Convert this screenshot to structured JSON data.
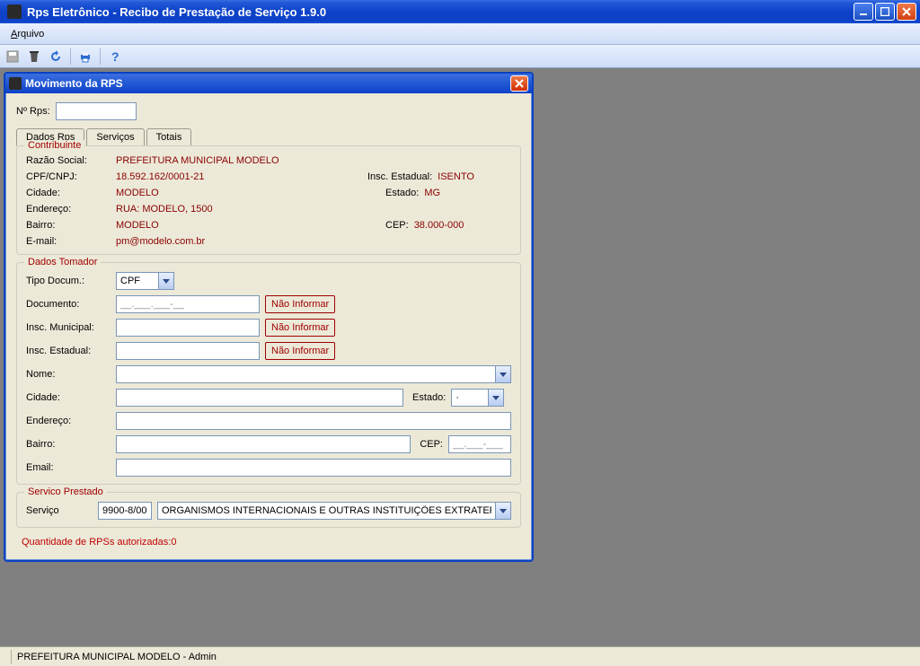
{
  "app": {
    "title": "Rps Eletrônico - Recibo de Prestação de Serviço 1.9.0"
  },
  "menubar": {
    "arquivo": "Arquivo"
  },
  "inner": {
    "title": "Movimento da RPS",
    "nrps_label": "Nº Rps:",
    "nrps_value": ""
  },
  "tabs": {
    "dadosRps": "Dados Rps",
    "servicos": "Serviços",
    "totais": "Totais"
  },
  "contribuinte": {
    "legend": "Contribuinte",
    "razao_social_lbl": "Razão Social:",
    "razao_social": "PREFEITURA MUNICIPAL MODELO",
    "cpf_cnpj_lbl": "CPF/CNPJ:",
    "cpf_cnpj": "18.592.162/0001-21",
    "insc_estadual_lbl": "Insc. Estadual:",
    "insc_estadual": "ISENTO",
    "cidade_lbl": "Cidade:",
    "cidade": "MODELO",
    "estado_lbl": "Estado:",
    "estado": "MG",
    "endereco_lbl": "Endereço:",
    "endereco": "RUA: MODELO, 1500",
    "bairro_lbl": "Bairro:",
    "bairro": "MODELO",
    "cep_lbl": "CEP:",
    "cep": "38.000-000",
    "email_lbl": "E-mail:",
    "email": "pm@modelo.com.br"
  },
  "tomador": {
    "legend": "Dados Tomador",
    "tipo_docum_lbl": "Tipo Docum.:",
    "tipo_docum": "CPF",
    "documento_lbl": "Documento:",
    "documento": "__.___.___-__",
    "insc_municipal_lbl": "Insc. Municipal:",
    "insc_municipal": "",
    "insc_estadual_lbl": "Insc. Estadual:",
    "insc_estadual": "",
    "nome_lbl": "Nome:",
    "nome": "",
    "cidade_lbl": "Cidade:",
    "cidade": "",
    "estado_lbl": "Estado:",
    "estado": "·",
    "endereco_lbl": "Endereço:",
    "endereco": "",
    "bairro_lbl": "Bairro:",
    "bairro": "",
    "cep_lbl": "CEP:",
    "cep": "__.___-___",
    "email_lbl": "Email:",
    "email": "",
    "nao_informar": "Não Informar"
  },
  "servico": {
    "legend": "Servico Prestado",
    "servico_lbl": "Serviço",
    "codigo": "9900-8/00",
    "descricao": "ORGANISMOS INTERNACIONAIS E OUTRAS INSTITUIÇÕES EXTRATERRI"
  },
  "status": "Quantidade de RPSs autorizadas:0",
  "statusbar": "PREFEITURA MUNICIPAL MODELO - Admin"
}
